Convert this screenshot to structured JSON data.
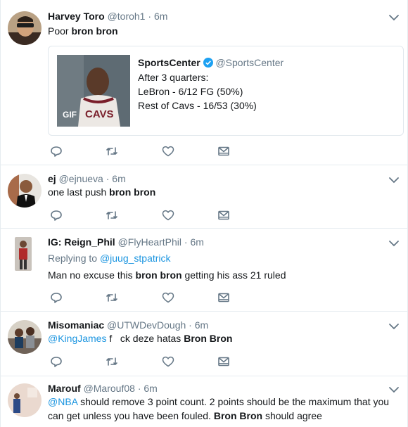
{
  "tweets": [
    {
      "name": "Harvey Toro",
      "handle": "@toroh1",
      "dot": "·",
      "time": "6m",
      "text_pre": "Poor ",
      "text_bold": "bron bron",
      "quote": {
        "name": "SportsCenter",
        "handle": "@SportsCenter",
        "badge": "GIF",
        "jersey": "CAVS",
        "line1": "After 3 quarters:",
        "line2": "LeBron - 6/12 FG (50%)",
        "line3": "Rest of Cavs - 16/53 (30%)"
      }
    },
    {
      "name": "ej",
      "handle": "@ejnueva",
      "dot": "·",
      "time": "6m",
      "text_pre": "one last push ",
      "text_bold": "bron bron"
    },
    {
      "name": "IG: Reign_Phil",
      "handle": "@FlyHeartPhil",
      "dot": "·",
      "time": "6m",
      "replying_to": "Replying to ",
      "replying_handle": "@juug_stpatrick",
      "text_pre": "Man no excuse this ",
      "text_bold": "bron bron",
      "text_post": " getting his ass 21 ruled"
    },
    {
      "name": "Misomaniac",
      "handle": "@UTWDevDough",
      "dot": "·",
      "time": "6m",
      "mention": "@KingJames",
      "text_pre": " f   ck deze hatas ",
      "text_bold": "Bron Bron"
    },
    {
      "name": "Marouf",
      "handle": "@Marouf08",
      "dot": "·",
      "time": "6m",
      "mention": "@NBA",
      "text_pre": " should remove 3 point count. 2 points should be the maximum that you can get unless you have been fouled. ",
      "text_bold": "Bron Bron",
      "text_post": " should agree"
    }
  ],
  "icons": {
    "reply": "reply-icon",
    "retweet": "retweet-icon",
    "like": "heart-icon",
    "dm": "envelope-icon",
    "chevron": "chevron-down-icon",
    "verified": "verified-badge-icon"
  },
  "colors": {
    "link": "#1b95e0",
    "muted": "#657786",
    "text": "#14171a",
    "border": "#e6ecf0"
  }
}
